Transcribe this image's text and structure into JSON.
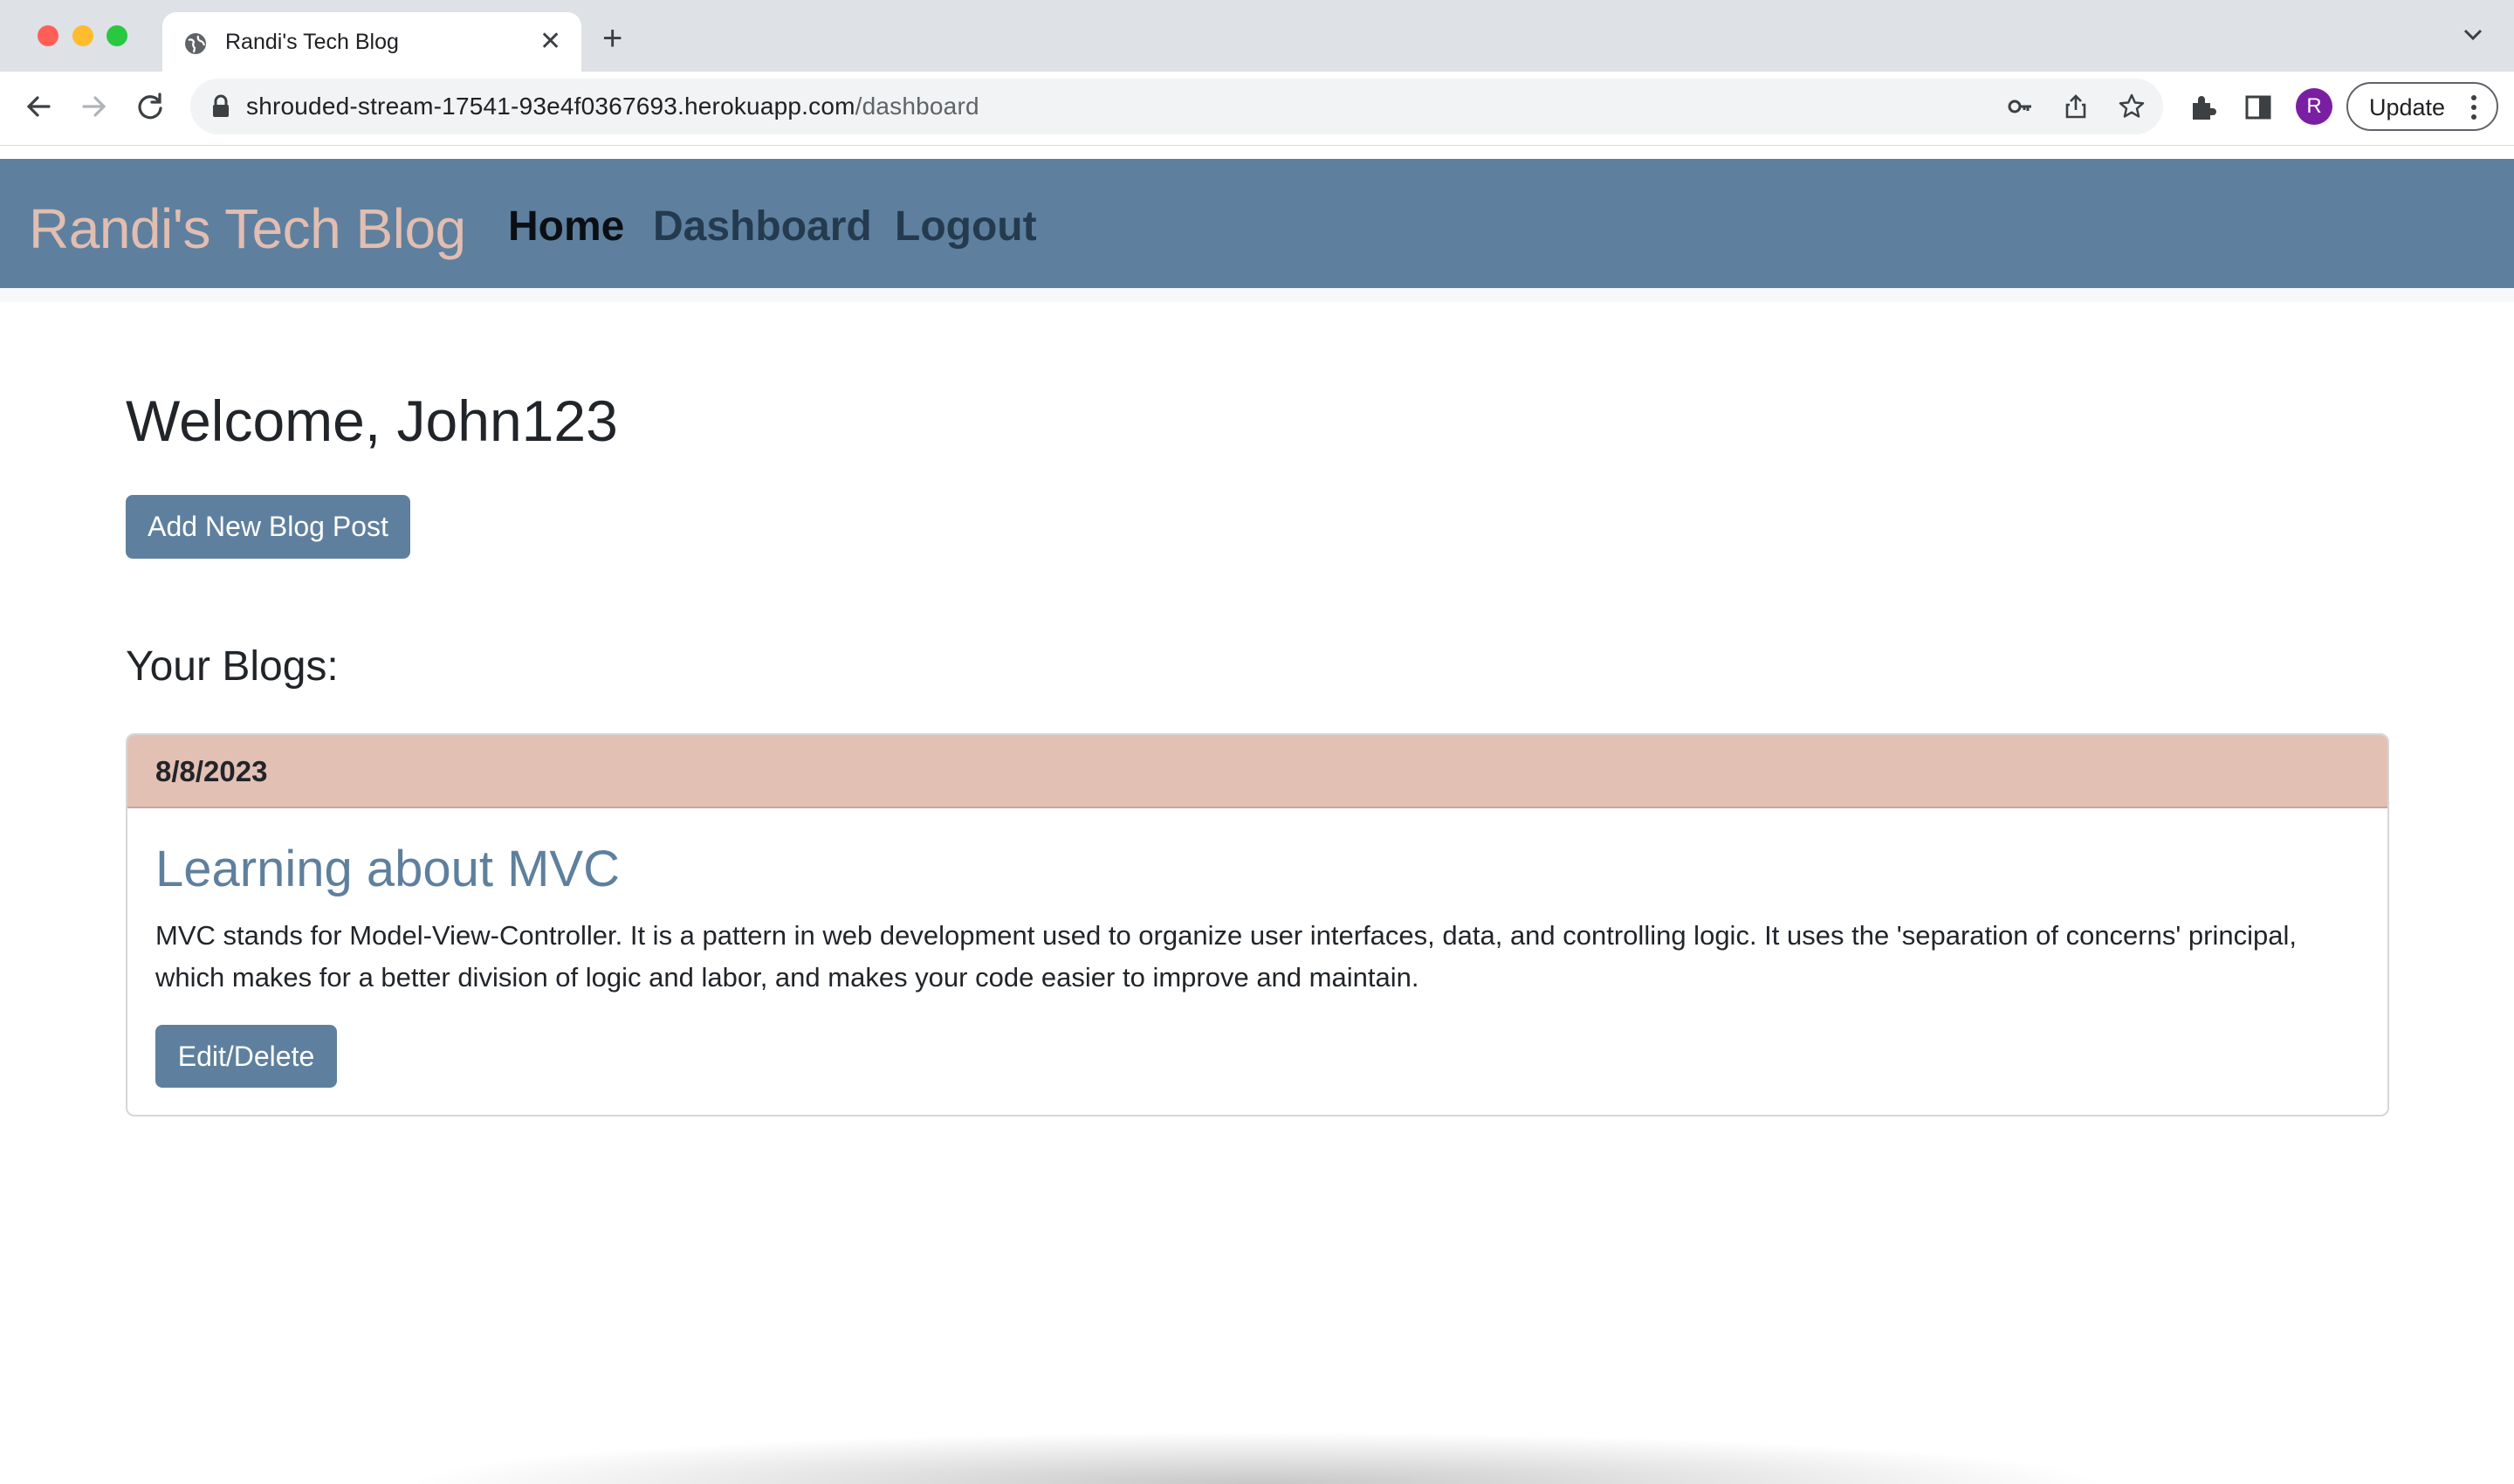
{
  "browser": {
    "tab": {
      "title": "Randi's Tech Blog"
    },
    "url": {
      "host": "shrouded-stream-17541-93e4f0367693.herokuapp.com",
      "path": "/dashboard"
    },
    "profile_initial": "R",
    "update_label": "Update",
    "icons": [
      "back-arrow-icon",
      "forward-arrow-icon",
      "reload-icon",
      "lock-icon",
      "key-icon",
      "share-icon",
      "star-icon",
      "extensions-icon",
      "side-panel-icon",
      "kebab-menu-icon"
    ]
  },
  "site": {
    "brand": "Randi's Tech Blog",
    "nav": [
      {
        "label": "Home"
      },
      {
        "label": "Dashboard"
      },
      {
        "label": "Logout"
      }
    ],
    "colors": {
      "navbar": "#5e809e",
      "brand": "#e2bdb1",
      "card_header": "#e3c0b4",
      "button": "#5e809e"
    }
  },
  "dashboard": {
    "welcome": "Welcome, John123",
    "add_button": "Add New Blog Post",
    "section_title": "Your Blogs:",
    "posts": [
      {
        "date": "8/8/2023",
        "title": "Learning about MVC",
        "body": "MVC stands for Model-View-Controller. It is a pattern in web development used to organize user interfaces, data, and controlling logic. It uses the 'separation of concerns' principal, which makes for a better division of logic and labor, and makes your code easier to improve and maintain.",
        "action": "Edit/Delete"
      }
    ]
  }
}
